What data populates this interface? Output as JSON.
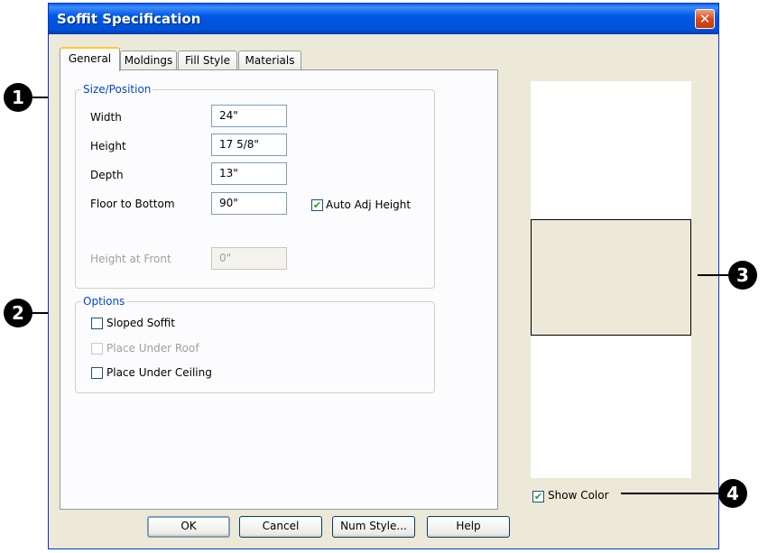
{
  "window": {
    "title": "Soffit Specification",
    "close_symbol": "✕"
  },
  "tabs": [
    {
      "label": "General",
      "active": true
    },
    {
      "label": "Moldings",
      "active": false
    },
    {
      "label": "Fill Style",
      "active": false
    },
    {
      "label": "Materials",
      "active": false
    }
  ],
  "size_position": {
    "group_label": "Size/Position",
    "width": {
      "label": "Width",
      "value": "24\""
    },
    "height": {
      "label": "Height",
      "value": "17 5/8\""
    },
    "depth": {
      "label": "Depth",
      "value": "13\""
    },
    "floor_to_bottom": {
      "label": "Floor to Bottom",
      "value": "90\""
    },
    "auto_adj_height": {
      "label": "Auto Adj Height",
      "checked": true
    },
    "height_at_front": {
      "label": "Height at Front",
      "value": "0\"",
      "enabled": false
    }
  },
  "options": {
    "group_label": "Options",
    "sloped_soffit": {
      "label": "Sloped Soffit",
      "checked": false
    },
    "place_under_roof": {
      "label": "Place Under Roof",
      "checked": false,
      "enabled": false
    },
    "place_under_ceiling": {
      "label": "Place Under Ceiling",
      "checked": false
    }
  },
  "show_color": {
    "label": "Show Color",
    "checked": true
  },
  "buttons": {
    "ok": "OK",
    "cancel": "Cancel",
    "num_style": "Num Style...",
    "help": "Help"
  },
  "callouts": [
    "1",
    "2",
    "3",
    "4"
  ],
  "colors": {
    "titlebar": "#0058e6",
    "dialog_bg": "#ece9d8",
    "group_label": "#0046d5",
    "checkmark": "#21a121",
    "preview_fill": "#ece9d8"
  },
  "check_symbol": "✔"
}
